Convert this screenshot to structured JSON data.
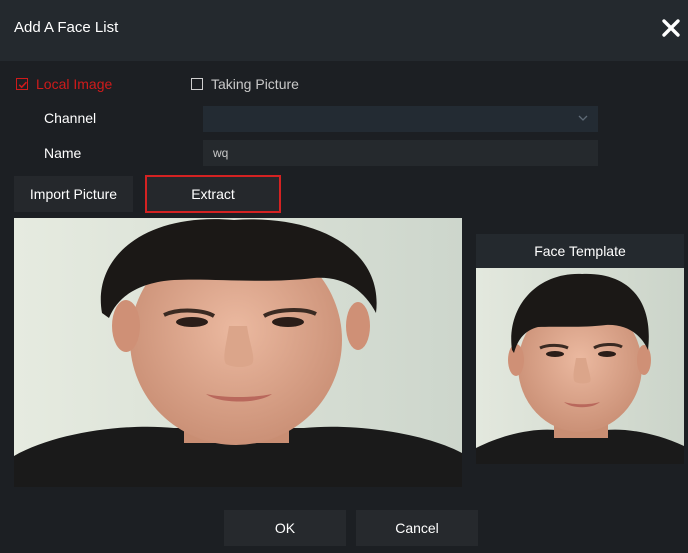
{
  "dialog": {
    "title": "Add A Face List"
  },
  "source_options": {
    "local_image": {
      "label": "Local Image",
      "checked": true
    },
    "taking_picture": {
      "label": "Taking Picture",
      "checked": false
    }
  },
  "form": {
    "channel": {
      "label": "Channel",
      "value": ""
    },
    "name": {
      "label": "Name",
      "value": "wq"
    }
  },
  "actions": {
    "import_label": "Import Picture",
    "extract_label": "Extract"
  },
  "template": {
    "header": "Face Template"
  },
  "footer": {
    "ok_label": "OK",
    "cancel_label": "Cancel"
  },
  "colors": {
    "accent_red": "#cf1b1b",
    "panel": "#1c1f23",
    "titlebar": "#24292e"
  },
  "icons": {
    "close": "close-icon",
    "checkbox": "checkbox-icon",
    "dropdown": "chevron-down-icon"
  }
}
